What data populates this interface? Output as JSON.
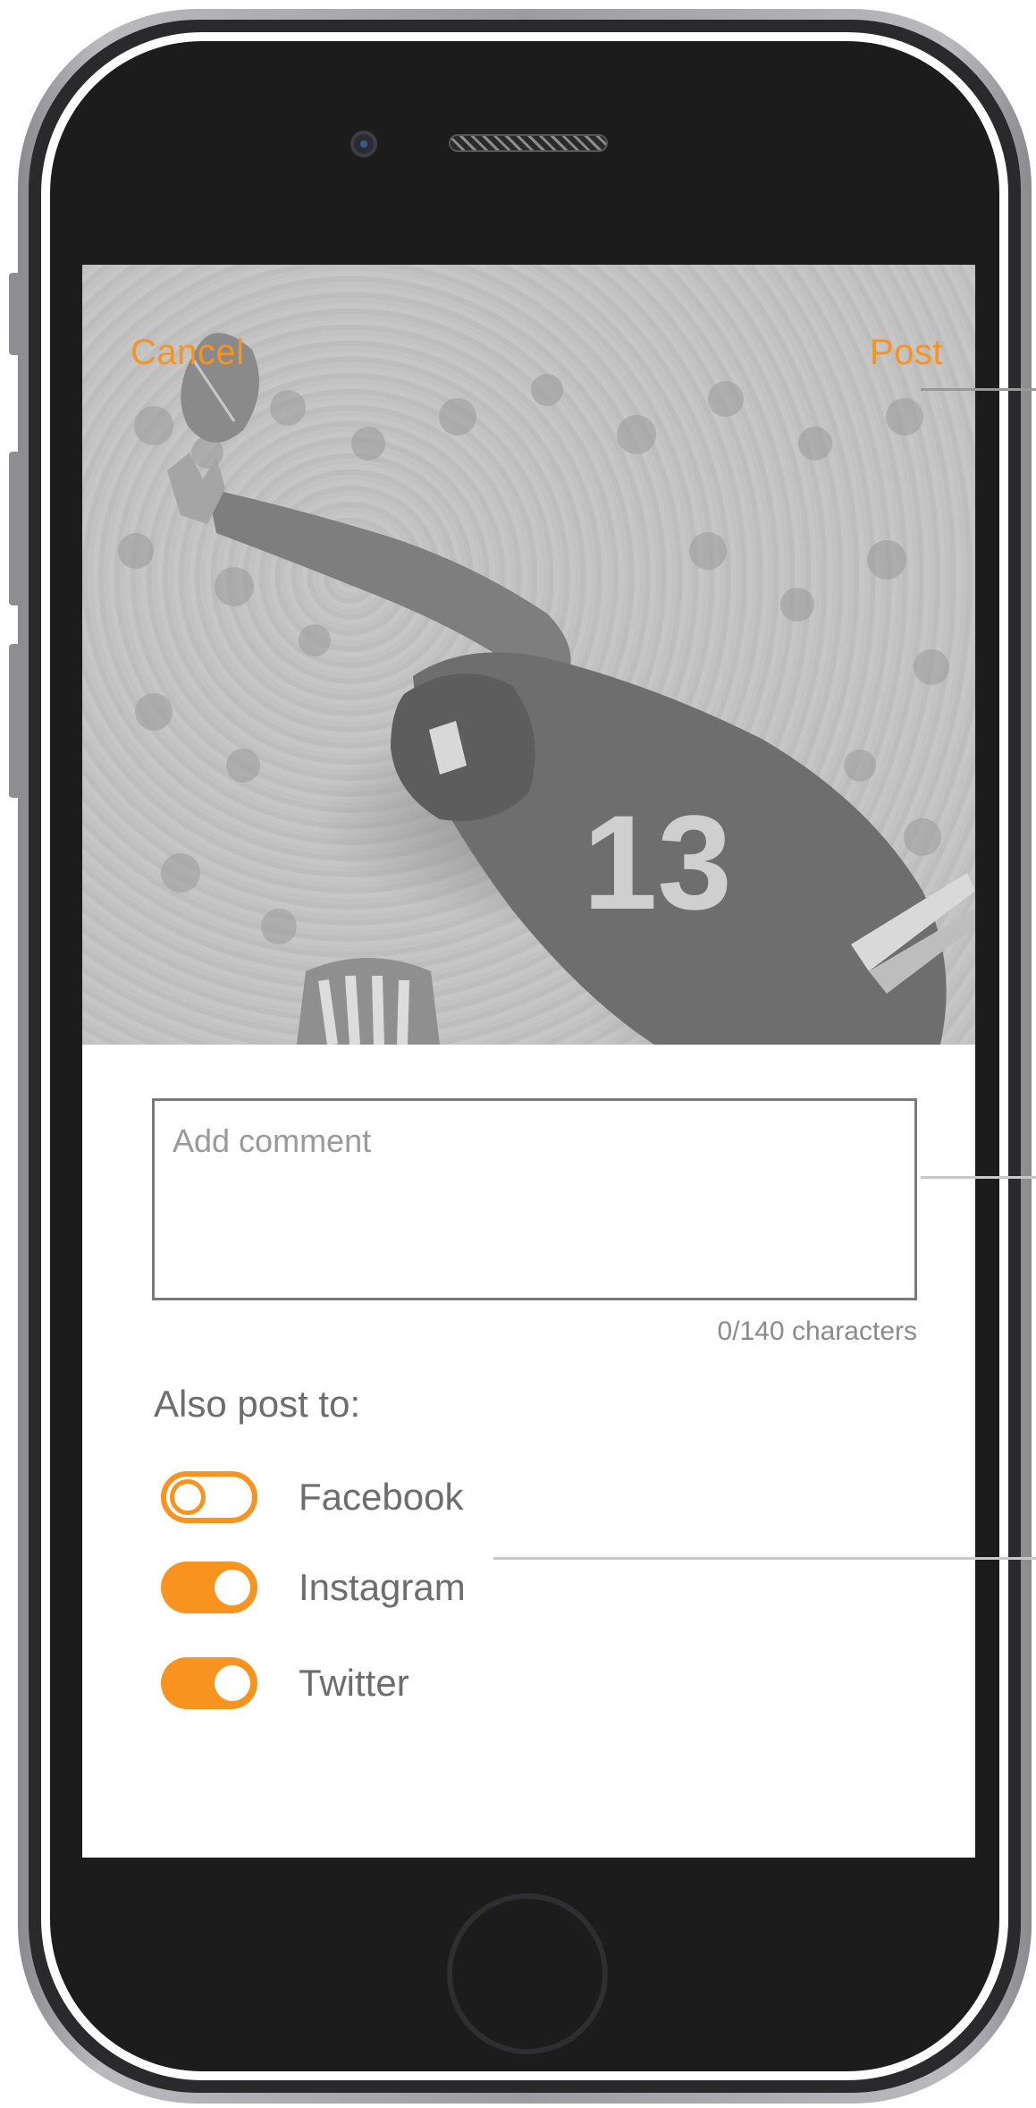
{
  "header": {
    "cancel_label": "Cancel",
    "post_label": "Post"
  },
  "hero": {
    "jersey_number": "13",
    "helmet_logo": "ny"
  },
  "comment": {
    "placeholder": "Add comment",
    "value": "",
    "char_count": "0/140 characters"
  },
  "share": {
    "heading": "Also post to:",
    "options": [
      {
        "label": "Facebook",
        "enabled": false
      },
      {
        "label": "Instagram",
        "enabled": true
      },
      {
        "label": "Twitter",
        "enabled": true
      }
    ]
  },
  "colors": {
    "accent": "#f7931e",
    "text": "#6d6d6d",
    "hero_tint": "#c2c2c2"
  }
}
